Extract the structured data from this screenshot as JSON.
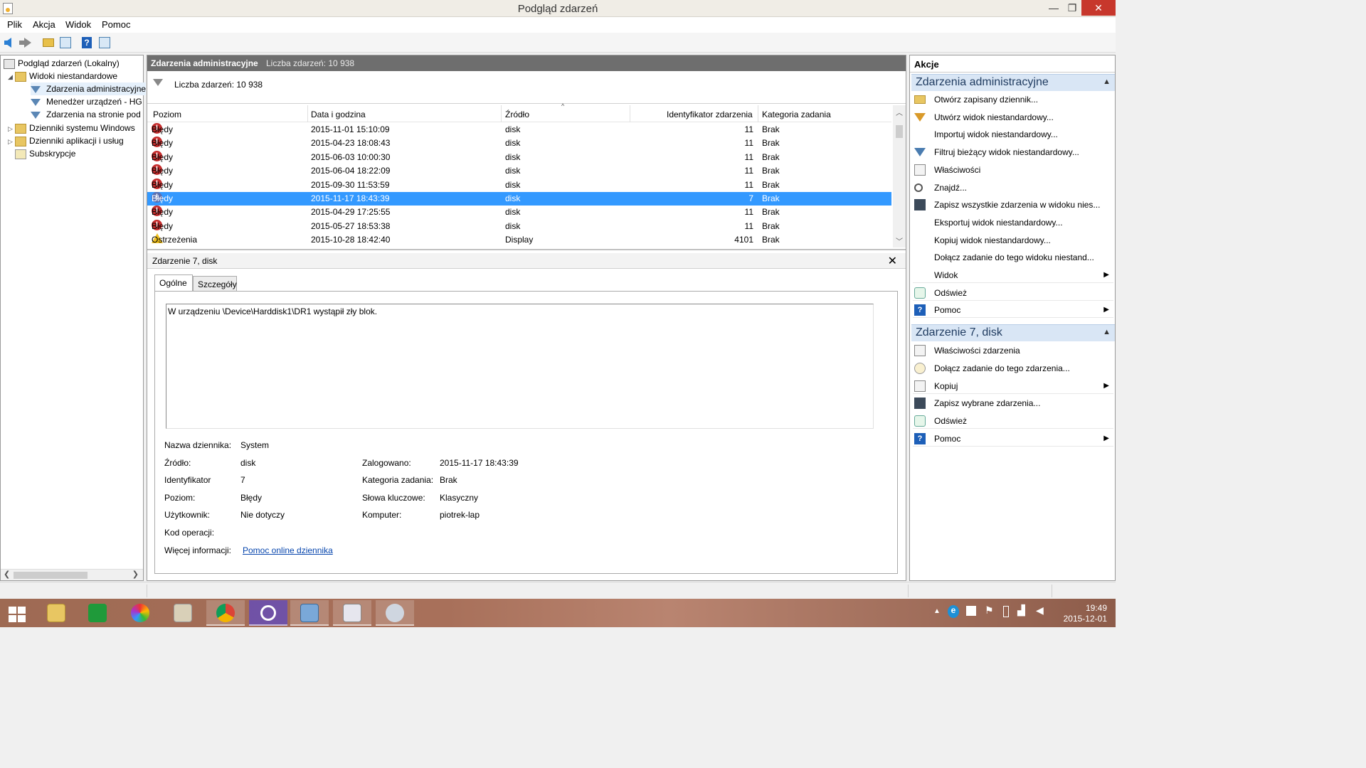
{
  "window": {
    "title": "Podgląd zdarzeń",
    "minimize": "—",
    "maximize": "❐",
    "close": "✕"
  },
  "menu": [
    "Plik",
    "Akcja",
    "Widok",
    "Pomoc"
  ],
  "tree": {
    "items": [
      {
        "label": "Podgląd zdarzeń (Lokalny)",
        "icon": "event-viewer-icon"
      },
      {
        "label": "Widoki niestandardowe",
        "icon": "folder-icon",
        "expander": "◢"
      },
      {
        "label": "Zdarzenia administracyjne",
        "icon": "filter-icon"
      },
      {
        "label": "Menedżer urządzeń - HG",
        "icon": "filter-icon"
      },
      {
        "label": "Zdarzenia na stronie pod",
        "icon": "filter-icon"
      },
      {
        "label": "Dzienniki systemu Windows",
        "icon": "folder-icon",
        "expander": "▷"
      },
      {
        "label": "Dzienniki aplikacji i usług",
        "icon": "folder-icon",
        "expander": "▷"
      },
      {
        "label": "Subskrypcje",
        "icon": "subscriptions-icon"
      }
    ]
  },
  "center": {
    "title": "Zdarzenia administracyjne",
    "count_label": "Liczba zdarzeń: 10 938",
    "filter_text": "Liczba zdarzeń: 10 938",
    "columns": [
      "Poziom",
      "Data i godzina",
      "Źródło",
      "Identyfikator zdarzenia",
      "Kategoria zadania"
    ],
    "rows": [
      {
        "level": "Błędy",
        "type": "error",
        "date": "2015-11-01 15:10:09",
        "source": "disk",
        "id": "11",
        "category": "Brak"
      },
      {
        "level": "Błędy",
        "type": "error",
        "date": "2015-04-23 18:08:43",
        "source": "disk",
        "id": "11",
        "category": "Brak"
      },
      {
        "level": "Błędy",
        "type": "error",
        "date": "2015-06-03 10:00:30",
        "source": "disk",
        "id": "11",
        "category": "Brak"
      },
      {
        "level": "Błędy",
        "type": "error",
        "date": "2015-06-04 18:22:09",
        "source": "disk",
        "id": "11",
        "category": "Brak"
      },
      {
        "level": "Błędy",
        "type": "error",
        "date": "2015-09-30 11:53:59",
        "source": "disk",
        "id": "11",
        "category": "Brak"
      },
      {
        "level": "Błędy",
        "type": "error",
        "date": "2015-11-17 18:43:39",
        "source": "disk",
        "id": "7",
        "category": "Brak",
        "selected": true
      },
      {
        "level": "Błędy",
        "type": "error",
        "date": "2015-04-29 17:25:55",
        "source": "disk",
        "id": "11",
        "category": "Brak"
      },
      {
        "level": "Błędy",
        "type": "error",
        "date": "2015-05-27 18:53:38",
        "source": "disk",
        "id": "11",
        "category": "Brak"
      },
      {
        "level": "Ostrzeżenia",
        "type": "warning",
        "date": "2015-10-28 18:42:40",
        "source": "Display",
        "id": "4101",
        "category": "Brak"
      }
    ]
  },
  "detail": {
    "title": "Zdarzenie 7, disk",
    "close": "✕",
    "tabs": [
      "Ogólne",
      "Szczegóły"
    ],
    "description": "W urządzeniu \\Device\\Harddisk1\\DR1 wystąpił zły blok.",
    "props_left": [
      {
        "label": "Nazwa dziennika:",
        "value": "System"
      },
      {
        "label": "Źródło:",
        "value": "disk"
      },
      {
        "label": "Identyfikator",
        "value": "7"
      },
      {
        "label": "Poziom:",
        "value": "Błędy"
      },
      {
        "label": "Użytkownik:",
        "value": "Nie dotyczy"
      },
      {
        "label": "Kod operacji:",
        "value": ""
      },
      {
        "label": "Więcej informacji:",
        "value": "Pomoc online dziennika"
      }
    ],
    "props_right": [
      {
        "label": "Zalogowano:",
        "value": "2015-11-17 18:43:39"
      },
      {
        "label": "Kategoria zadania:",
        "value": "Brak"
      },
      {
        "label": "Słowa kluczowe:",
        "value": "Klasyczny"
      },
      {
        "label": "Komputer:",
        "value": "piotrek-lap"
      }
    ]
  },
  "actions": {
    "title": "Akcje",
    "section1": {
      "title": "Zdarzenia administracyjne",
      "items": [
        {
          "label": "Otwórz zapisany dziennik...",
          "icon": "open-folder-icon"
        },
        {
          "label": "Utwórz widok niestandardowy...",
          "icon": "create-filter-icon"
        },
        {
          "label": "Importuj widok niestandardowy...",
          "icon": ""
        },
        {
          "label": "Filtruj bieżący widok niestandardowy...",
          "icon": "filter-icon"
        },
        {
          "label": "Właściwości",
          "icon": "properties-icon"
        },
        {
          "label": "Znajdź...",
          "icon": "binoculars-icon"
        },
        {
          "label": "Zapisz wszystkie zdarzenia w widoku nies...",
          "icon": "save-icon"
        },
        {
          "label": "Eksportuj widok niestandardowy...",
          "icon": ""
        },
        {
          "label": "Kopiuj widok niestandardowy...",
          "icon": ""
        },
        {
          "label": "Dołącz zadanie do tego widoku niestand...",
          "icon": ""
        },
        {
          "label": "Widok",
          "icon": "",
          "submenu": "▶"
        },
        {
          "label": "Odśwież",
          "icon": "refresh-icon"
        },
        {
          "label": "Pomoc",
          "icon": "help-icon",
          "submenu": "▶"
        }
      ]
    },
    "section2": {
      "title": "Zdarzenie 7, disk",
      "items": [
        {
          "label": "Właściwości zdarzenia",
          "icon": "properties-icon"
        },
        {
          "label": "Dołącz zadanie do tego zdarzenia...",
          "icon": "task-icon"
        },
        {
          "label": "Kopiuj",
          "icon": "copy-icon",
          "submenu": "▶"
        },
        {
          "label": "Zapisz wybrane zdarzenia...",
          "icon": "save-icon"
        },
        {
          "label": "Odśwież",
          "icon": "refresh-icon"
        },
        {
          "label": "Pomoc",
          "icon": "help-icon",
          "submenu": "▶"
        }
      ]
    },
    "collapse": "▲"
  },
  "taskbar": {
    "clock_time": "19:49",
    "clock_date": "2015-12-01",
    "apps": [
      "start-icon",
      "file-explorer-icon",
      "store-icon",
      "picasa-icon",
      "notepad-icon",
      "chrome-icon",
      "settings-icon",
      "control-panel-icon",
      "event-viewer-icon",
      "paint-icon"
    ]
  }
}
